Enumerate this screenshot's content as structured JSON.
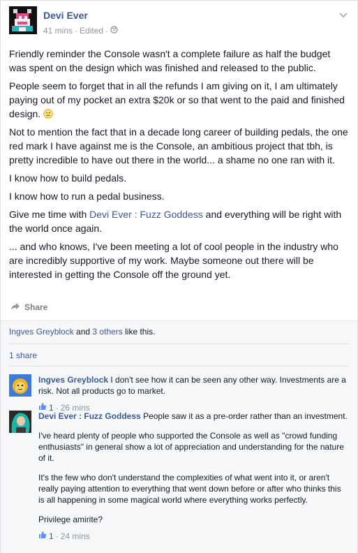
{
  "post": {
    "author": "Devi Ever",
    "time": "41 mins",
    "edited": "Edited",
    "sep": "·",
    "paragraphs": [
      "Friendly reminder the Console wasn't a complete failure as half the budget was spent on the design which was finished and released to the public.",
      "People seem to forget that in all the refunds I am giving on it, I am ultimately paying out of my pocket an extra $20k or so that went to the paid and finished design.",
      "Not to mention the fact that in a decade long career of building pedals, the one red mark I have against me is the Console, an ambitious project that tbh, is pretty incredible to have out there in the world... a shame no one ran with it.",
      "I know how to build pedals.",
      "I know how to run a pedal business.",
      "... and who knows, I've been meeting a lot of cool people in the industry who are incredibly supportive of my work. Maybe someone out there will be interested in getting the Console off the ground yet."
    ],
    "p7_before": "Give me time with ",
    "p7_link": "Devi Ever : Fuzz Goddess",
    "p7_after": " and everything will be right with the world once again."
  },
  "actions": {
    "share_label": "Share"
  },
  "likes": {
    "name": "Ingves Greyblock",
    "and": " and ",
    "others": "3 others",
    "suffix": " like this."
  },
  "shares": {
    "label": "1 share"
  },
  "comments": [
    {
      "name": "Ingves Greyblock",
      "paragraphs": [
        "I don't see how it can be seen any other way. Investments are a risk. Not all products go to market."
      ],
      "likes": "1",
      "time": "26 mins"
    },
    {
      "name": "Devi Ever : Fuzz Goddess",
      "paragraphs": [
        "People saw it as a pre-order rather than an investment.",
        "I've heard plenty of people who supported the Console as well as \"crowd funding enthusiasts\" in general show a lot of appreciation and understanding for the nature of it.",
        "It's the few who don't understand the complexities of what went into it, or aren't really paying attention to everything that went down before or after who thinks this is all happening in some magical world where everything works perfectly.",
        "Privilege amirite?"
      ],
      "likes": "1",
      "time": "24 mins"
    }
  ],
  "icons": {
    "globe": "globe-icon",
    "chevron": "chevron-down-icon",
    "share": "share-arrow-icon",
    "like": "thumbs-up-icon",
    "smile": "frown-emoticon-icon"
  },
  "colors": {
    "link": "#3b5998",
    "meta": "#90949c",
    "panel": "#f6f7f9"
  }
}
